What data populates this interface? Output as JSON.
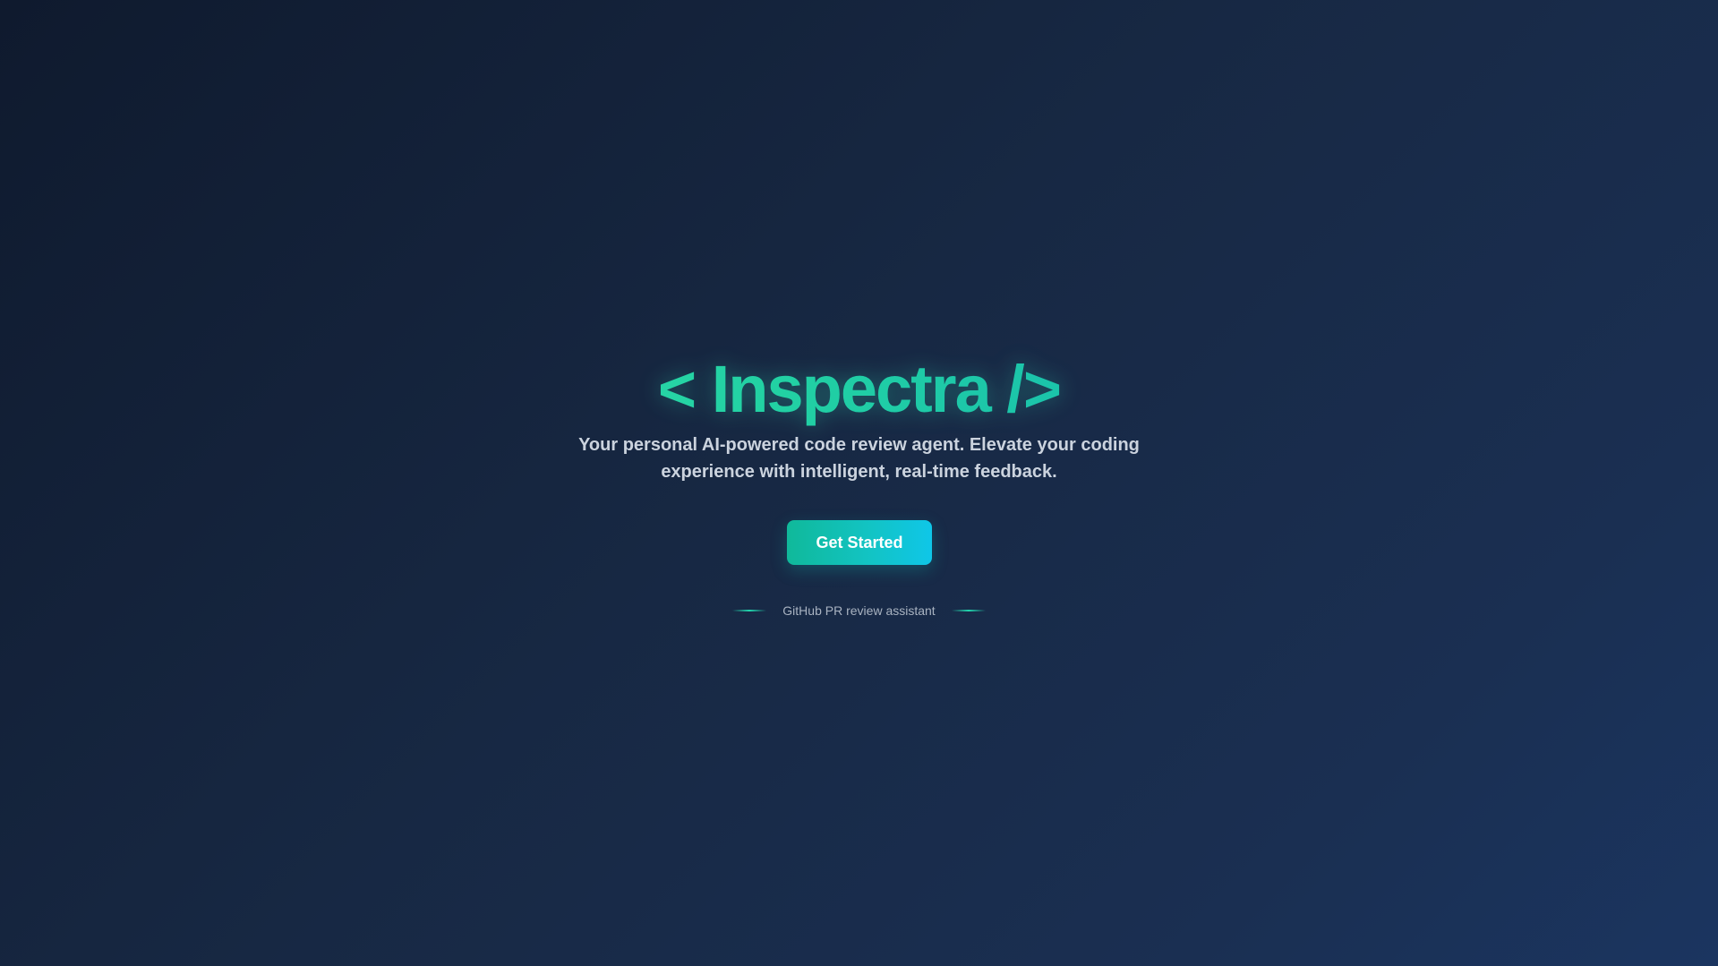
{
  "hero": {
    "title": "< Inspectra />",
    "subtitle_line1": "Your personal AI-powered code review agent. Elevate your coding",
    "subtitle_line2": "experience with intelligent, real-time feedback.",
    "cta_label": "Get Started",
    "tagline": "GitHub PR review assistant"
  },
  "colors": {
    "background_start": "#0f1a2e",
    "background_end": "#1b3560",
    "title_gradient_start": "#3ee6b0",
    "title_gradient_end": "#14c8dc",
    "button_gradient_start": "#10b99a",
    "button_gradient_end": "#0fc6e8",
    "subtitle_text": "#cbd3de",
    "tagline_text": "#a9b3c1"
  }
}
